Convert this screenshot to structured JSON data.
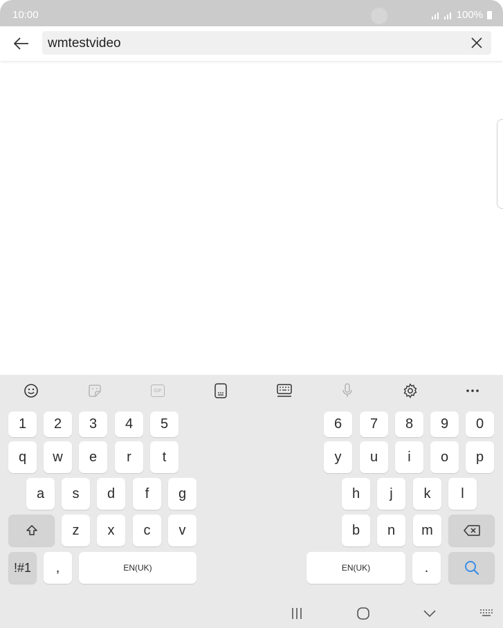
{
  "status_bar": {
    "time": "10:00",
    "battery": "100%"
  },
  "search": {
    "query": "wmtestvideo"
  },
  "keyboard": {
    "toolbar_icons": [
      "emoji-icon",
      "sticker-icon",
      "gif-icon",
      "keyboard-size-icon",
      "keyboard-mode-icon",
      "mic-icon",
      "settings-icon",
      "more-icon"
    ],
    "gif_label": "GIF",
    "numbers_left": [
      "1",
      "2",
      "3",
      "4",
      "5"
    ],
    "numbers_right": [
      "6",
      "7",
      "8",
      "9",
      "0"
    ],
    "row1_left": [
      "q",
      "w",
      "e",
      "r",
      "t"
    ],
    "row1_right": [
      "y",
      "u",
      "i",
      "o",
      "p"
    ],
    "row2_left": [
      "a",
      "s",
      "d",
      "f",
      "g"
    ],
    "row2_right": [
      "h",
      "j",
      "k",
      "l"
    ],
    "row3_left": [
      "z",
      "x",
      "c",
      "v"
    ],
    "row3_right": [
      "b",
      "n",
      "m"
    ],
    "symbols_label": "!#1",
    "comma": ",",
    "period": ".",
    "space_label_left": "EN(UK)",
    "space_label_right": "EN(UK)"
  },
  "colors": {
    "accent": "#3a8ee6",
    "status_bar": "#cbcbcb",
    "keyboard_bg": "#e9e9e9"
  }
}
